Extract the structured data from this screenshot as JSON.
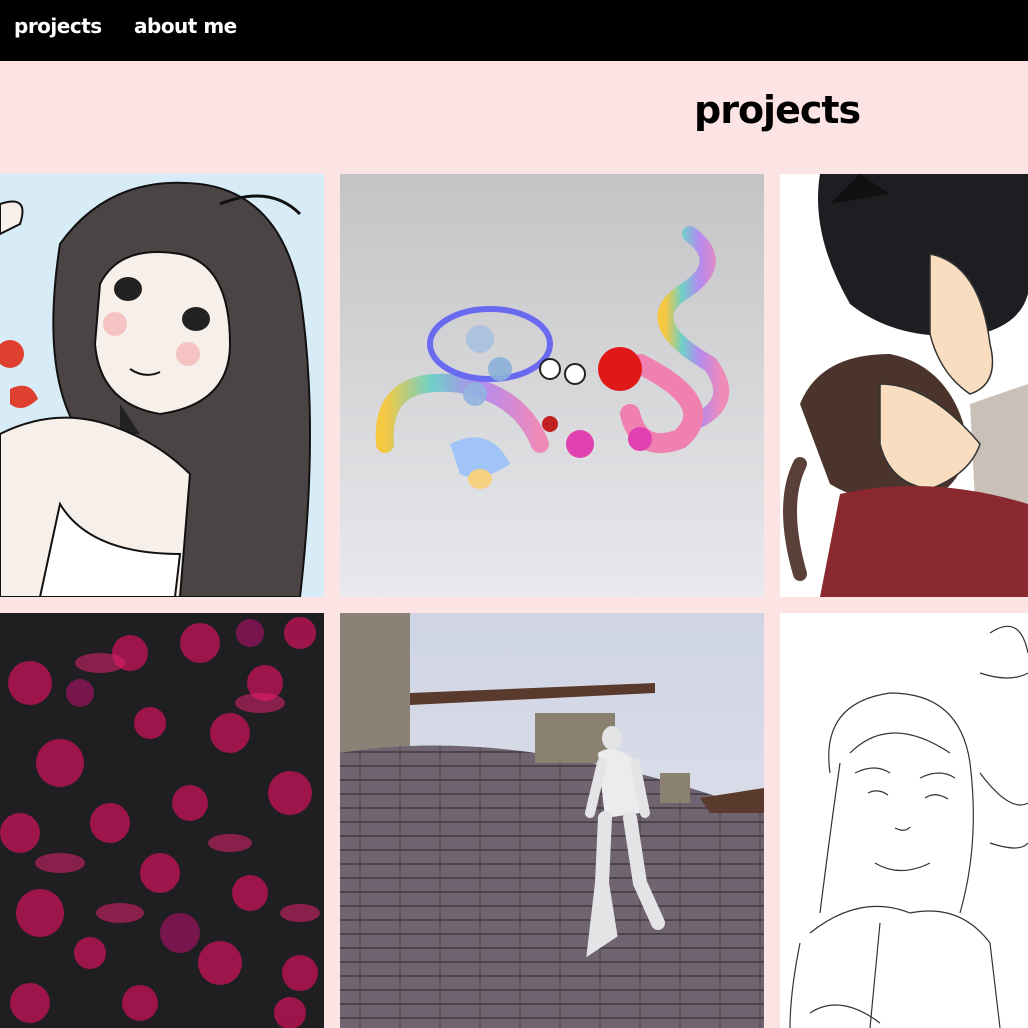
{
  "nav": {
    "links": [
      {
        "label": "projects"
      },
      {
        "label": "about me"
      }
    ]
  },
  "page": {
    "title": "projects"
  },
  "colors": {
    "nav_background": "#000000",
    "page_background": "#fde4e4",
    "nav_text": "#ffffff"
  },
  "gallery": {
    "items": [
      {
        "kind": "anime-girl-illustration"
      },
      {
        "kind": "3d-colorful-tubes-render"
      },
      {
        "kind": "cat-eared-couple-illustration"
      },
      {
        "kind": "pink-bubbles-abstract-art"
      },
      {
        "kind": "3d-mannequin-game-scene"
      },
      {
        "kind": "pencil-sketch-characters"
      }
    ]
  }
}
